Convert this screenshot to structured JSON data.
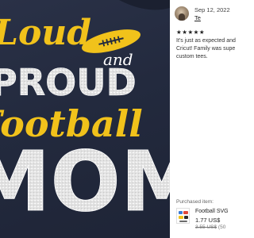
{
  "photo": {
    "line1": "Loud",
    "line2_accent": "and",
    "line3": "PROUD",
    "line4": "Football",
    "line5": "MOM"
  },
  "review": {
    "date": "Sep 12, 2022",
    "reviewer": "Te",
    "stars": "★★★★★",
    "rating": 5,
    "text_lines": [
      "It's just as expected and",
      "Cricut! Family was supe",
      "custom tees."
    ]
  },
  "purchased": {
    "label": "Purchased item:",
    "title": "Football SVG",
    "price": "1.77 US$",
    "original_price": "3.55 US$",
    "discount": "(50"
  },
  "colors": {
    "shirt": "#232a3e",
    "script_yellow": "#f1c21b",
    "glitter_white": "#e4e4e4"
  }
}
